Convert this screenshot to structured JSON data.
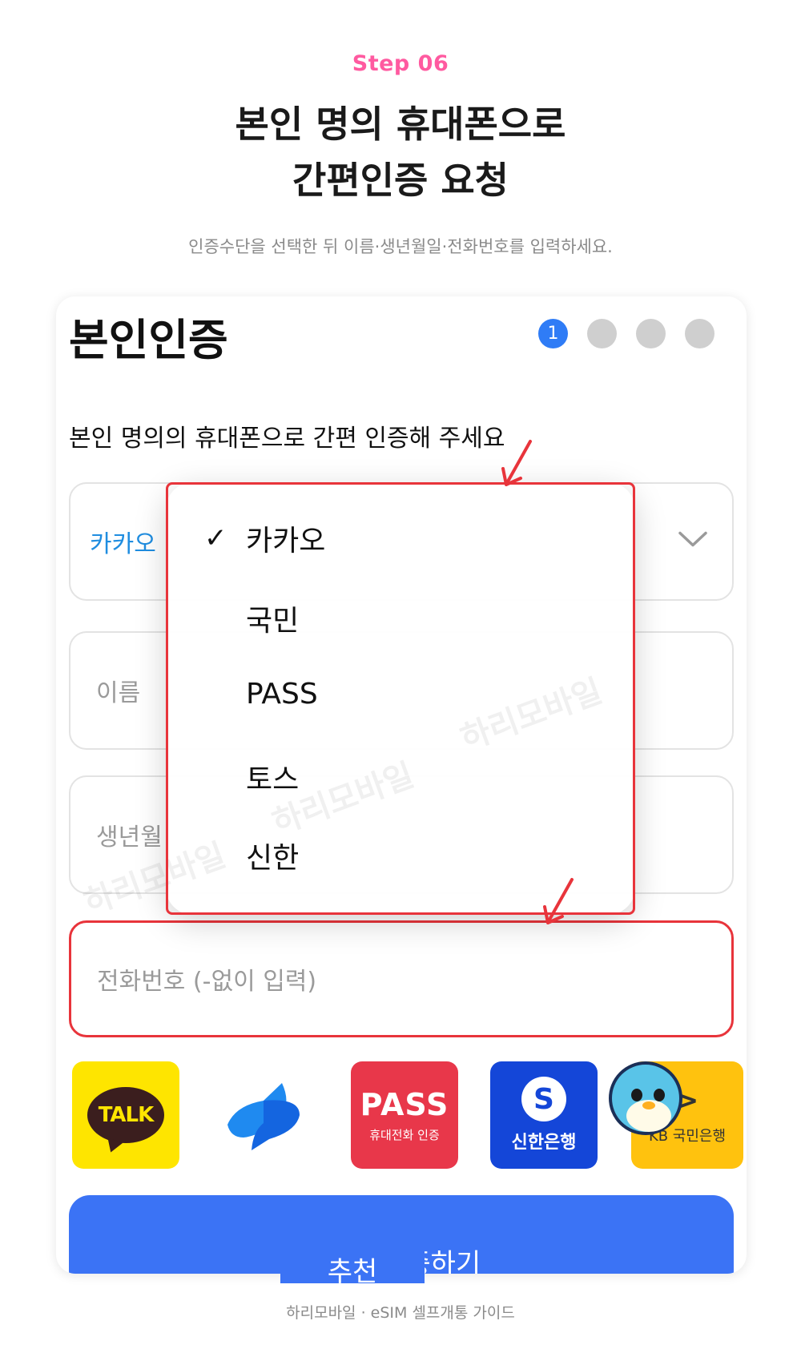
{
  "header": {
    "step": "Step 06",
    "title_line1": "본인 명의 휴대폰으로",
    "title_line2": "간편인증 요청",
    "subtitle": "인증수단을 선택한 뒤 이름·생년월일·전화번호를 입력하세요."
  },
  "card": {
    "title": "본인인증",
    "step_current": "1",
    "instruction": "본인 명의의 휴대폰으로 간편 인증해 주세요",
    "fields": {
      "carrier_value": "카카오",
      "name_placeholder": "이름",
      "birth_placeholder": "생년월",
      "phone_placeholder": "전화번호 (-없이 입력)"
    },
    "apps": {
      "kakao": "TALK",
      "pass_big": "PASS",
      "pass_small": "휴대전화 인증",
      "shinhan_mark": "S",
      "shinhan": "신한은행",
      "kb_mark": ">",
      "kb": "KB 국민은행"
    },
    "cta_label": "본인 인증하기",
    "cta_cover": "추천"
  },
  "dropdown": {
    "options": [
      "카카오",
      "국민",
      "PASS",
      "토스",
      "신한"
    ],
    "selected_index": 0,
    "check": "✓"
  },
  "watermark": "하리모바일",
  "footer": "하리모바일  ·  eSIM 셀프개통 가이드",
  "colors": {
    "accent_pink": "#ff5aa0",
    "primary_blue": "#3b73f5",
    "highlight_red": "#e8343b"
  }
}
